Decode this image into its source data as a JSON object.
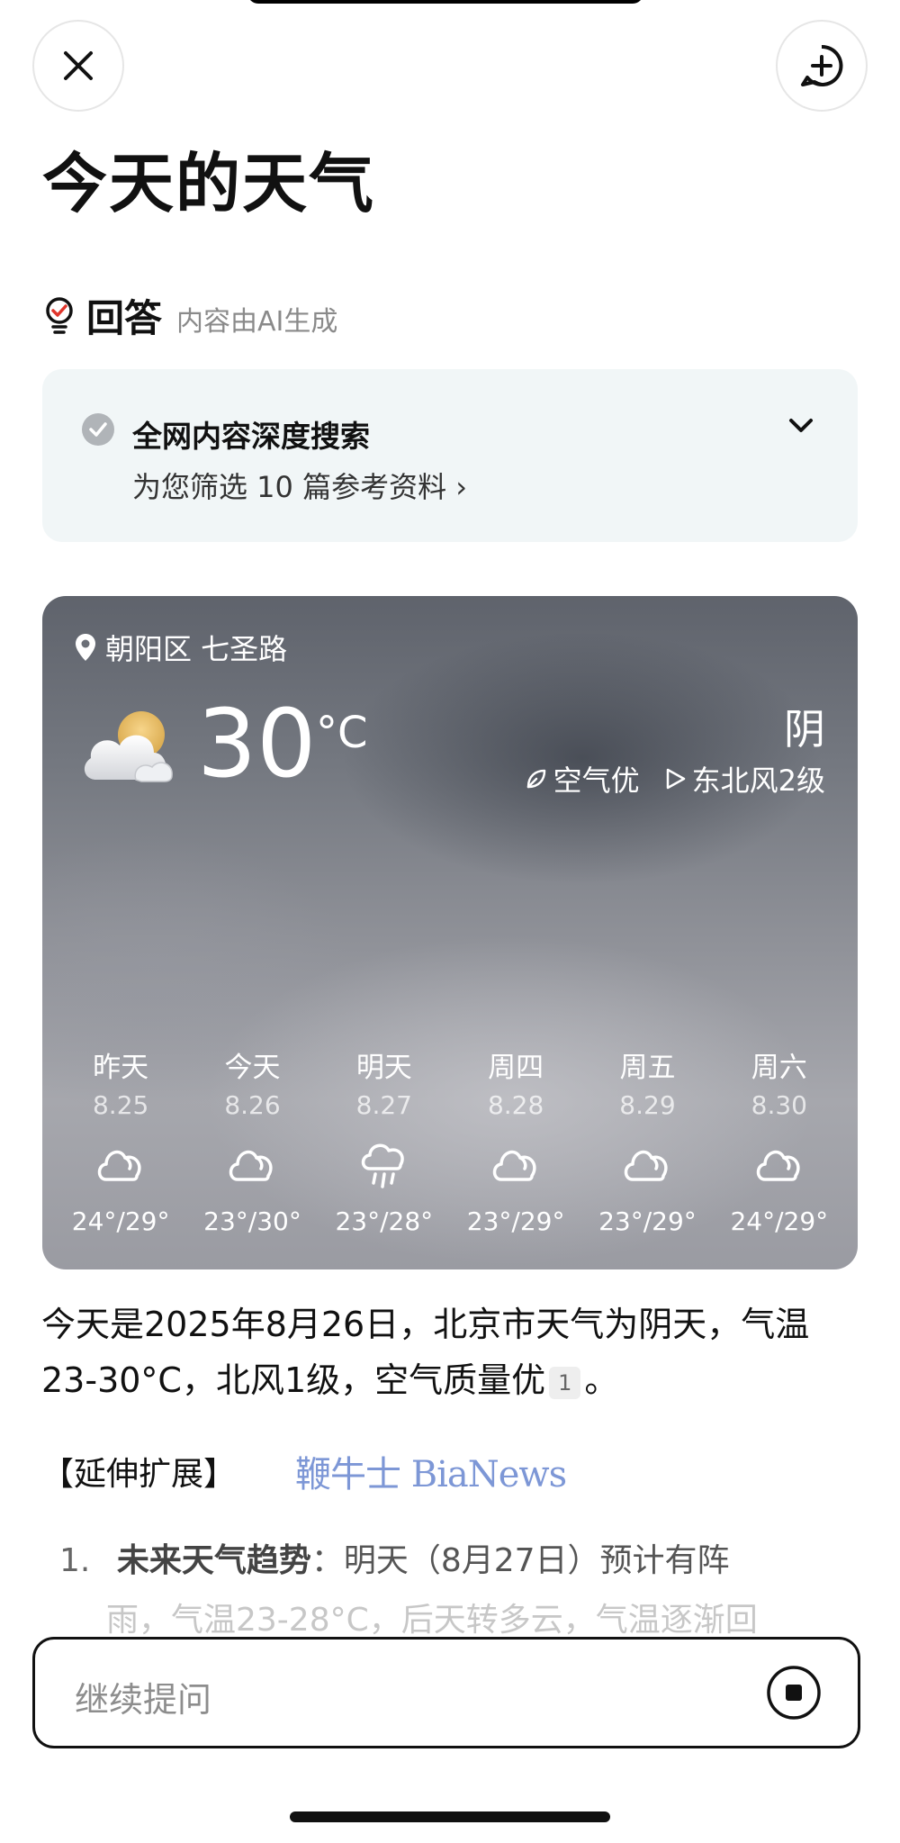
{
  "header": {
    "title": "今天的天气"
  },
  "answer": {
    "label": "回答",
    "sub": "内容由AI生成"
  },
  "search": {
    "title": "全网内容深度搜索",
    "sub": "为您筛选 10 篇参考资料 ›"
  },
  "weather": {
    "location": "朝阳区 七圣路",
    "temp": "30",
    "unit": "°C",
    "condition": "阴",
    "air": "空气优",
    "wind": "东北风2级",
    "days": [
      {
        "name": "昨天",
        "date": "8.25",
        "icon": "cloudy-icon",
        "range": "24°/29°"
      },
      {
        "name": "今天",
        "date": "8.26",
        "icon": "cloudy-icon",
        "range": "23°/30°"
      },
      {
        "name": "明天",
        "date": "8.27",
        "icon": "shower-icon",
        "range": "23°/28°"
      },
      {
        "name": "周四",
        "date": "8.28",
        "icon": "cloudy-icon",
        "range": "23°/29°"
      },
      {
        "name": "周五",
        "date": "8.29",
        "icon": "cloudy-icon",
        "range": "23°/29°"
      },
      {
        "name": "周六",
        "date": "8.30",
        "icon": "cloudy-icon",
        "range": "24°/29°"
      }
    ]
  },
  "summary": {
    "line1": "今天是2025年8月26日，北京市天气为阴天，气温",
    "line2": "23-30°C，北风1级，空气质量优",
    "cite": "1",
    "end": "。"
  },
  "extension": {
    "heading": "【延伸扩展】",
    "watermark": "鞭牛士 BiaNews"
  },
  "list": {
    "num": "1.",
    "bold": "未来天气趋势",
    "text": "：明天（8月27日）预计有阵",
    "faded": "雨，气温23-28°C，后天转多云，气温逐渐回"
  },
  "input": {
    "placeholder": "继续提问"
  }
}
